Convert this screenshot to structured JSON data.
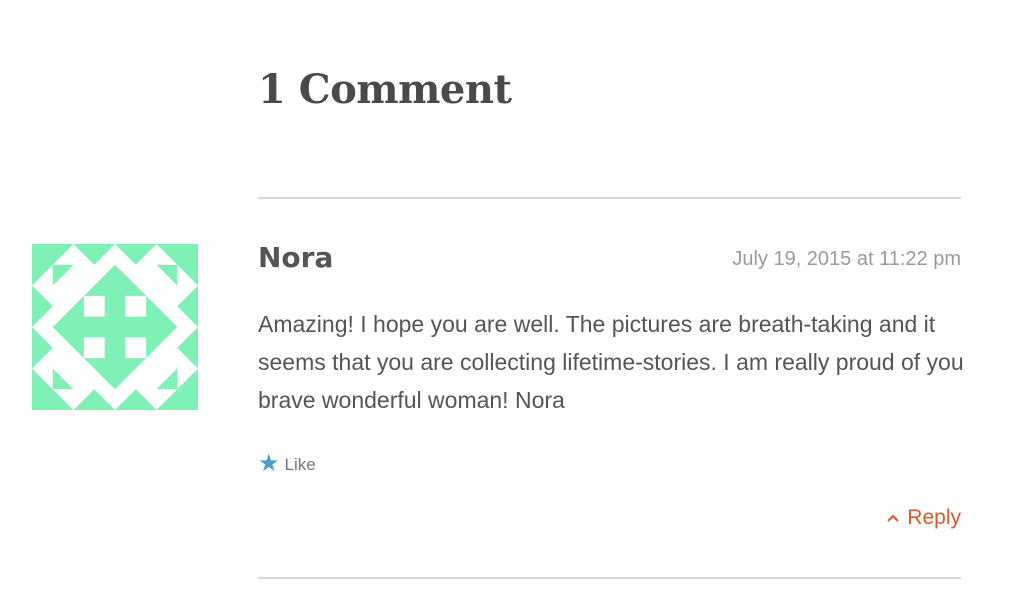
{
  "comments": {
    "title": "1 Comment",
    "items": [
      {
        "author": "Nora",
        "date": "July 19, 2015 at 11:22 pm",
        "text": "Amazing! I hope you are well. The pictures are breath-taking and it seems that you are collecting lifetime-stories. I am really proud of you brave wonderful woman! Nora",
        "avatar": {
          "icon": "identicon-avatar",
          "color": "#7ff0b6"
        },
        "like": {
          "icon": "star-icon",
          "label": "Like",
          "color": "#4a9fcf"
        },
        "reply": {
          "icon": "chevron-up-icon",
          "label": "Reply",
          "color": "#d9592e"
        }
      }
    ]
  }
}
